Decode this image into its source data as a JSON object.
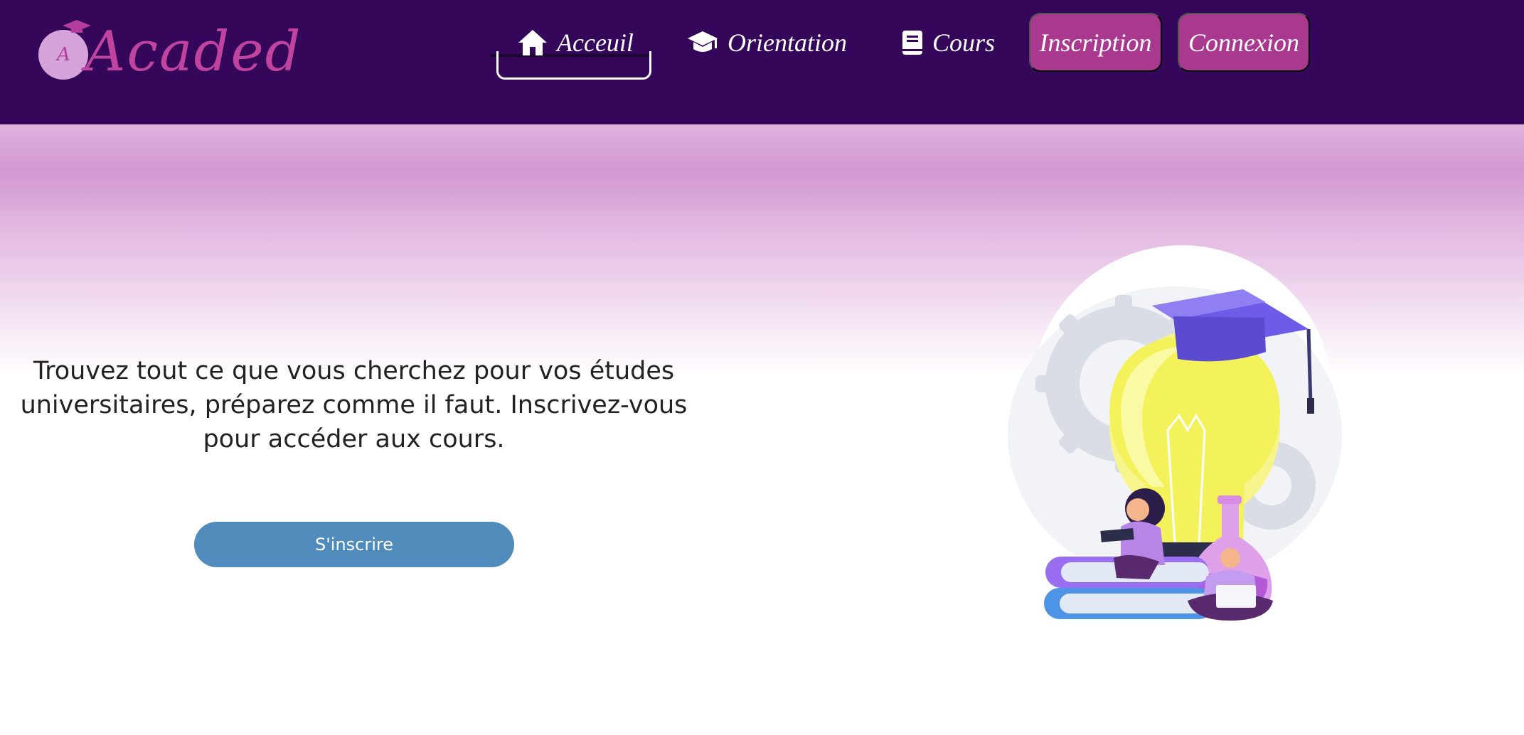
{
  "brand": {
    "name": "Acaded",
    "initial": "A"
  },
  "nav": {
    "items": [
      {
        "label": "Acceuil",
        "icon": "home-icon"
      },
      {
        "label": "Orientation",
        "icon": "graduation-cap-icon"
      },
      {
        "label": "Cours",
        "icon": "book-icon"
      }
    ],
    "buttons": [
      {
        "label": "Inscription"
      },
      {
        "label": "Connexion"
      }
    ]
  },
  "hero": {
    "text": "Trouvez tout ce que vous cherchez pour vos études universitaires, préparez comme il faut. Inscrivez-vous pour accéder aux cours.",
    "cta_label": "S'inscrire",
    "illustration": "education-lightbulb-illustration"
  },
  "colors": {
    "header_bg": "#35075a",
    "brand_pink": "#c0449f",
    "nav_button": "#a9398f",
    "cta": "#4f8bbb"
  }
}
